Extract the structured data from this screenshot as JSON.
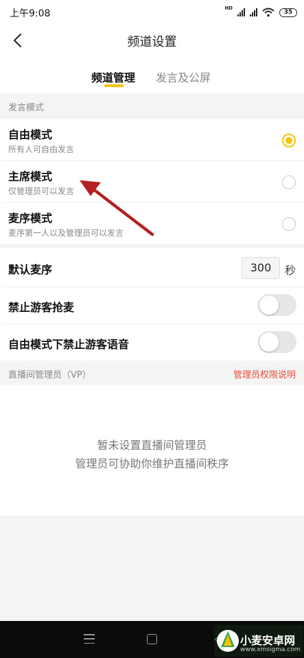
{
  "status_bar": {
    "time": "上午9:08",
    "network_label": "HD",
    "battery": "35"
  },
  "header": {
    "title": "频道设置"
  },
  "tabs": [
    {
      "label": "频道管理",
      "active": true
    },
    {
      "label": "发言及公屏",
      "active": false
    }
  ],
  "speak_mode": {
    "section_label": "发言模式",
    "modes": [
      {
        "title": "自由模式",
        "desc": "所有人可自由发言",
        "selected": true
      },
      {
        "title": "主席模式",
        "desc": "仅管理员可以发言",
        "selected": false
      },
      {
        "title": "麦序模式",
        "desc": "麦序第一人以及管理员可以发言",
        "selected": false
      }
    ]
  },
  "settings": {
    "default_mic": {
      "label": "默认麦序",
      "value": "300",
      "unit": "秒"
    },
    "ban_guest_grab_mic": {
      "label": "禁止游客抢麦",
      "enabled": false
    },
    "ban_guest_voice_free_mode": {
      "label": "自由模式下禁止游客语音",
      "enabled": false
    }
  },
  "admin_section": {
    "label": "直播间管理员（VP）",
    "link": "管理员权限说明",
    "empty_line1": "暂未设置直播间管理员",
    "empty_line2": "管理员可协助你维护直播间秩序"
  },
  "watermark": {
    "text": "小麦安卓网",
    "url": "www.xmsigma.com"
  },
  "colors": {
    "accent": "#f5c400",
    "link": "#e64c3c",
    "annotation_arrow": "#b3201f"
  }
}
